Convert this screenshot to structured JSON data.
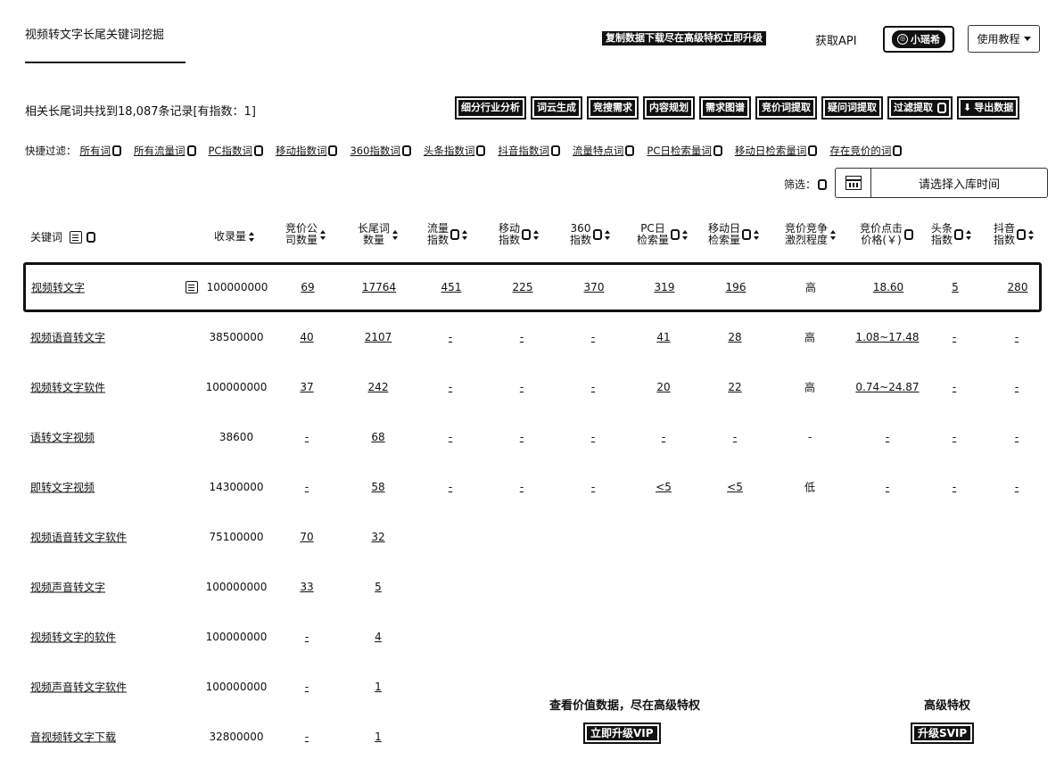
{
  "header": {
    "title": "视频转文字长尾关键词挖掘",
    "promo": "复制数据下载尽在高级特权立即升级",
    "api": "获取API",
    "xiaoshui": "小瑶希",
    "tutorial": "使用教程"
  },
  "summary": "相关长尾词共找到18,087条记录[有指数：1]",
  "tools": [
    "细分行业分析",
    "词云生成",
    "竞搜需求",
    "内容规划",
    "需求图谱",
    "竞价词提取",
    "疑问词提取",
    "过滤提取",
    "导出数据"
  ],
  "quick_filter": {
    "label": "快捷过滤：",
    "items": [
      "所有词",
      "所有流量词",
      "PC指数词",
      "移动指数词",
      "360指数词",
      "头条指数词",
      "抖音指数词",
      "流量特点词",
      "PC日检索量词",
      "移动日检索量词",
      "存在竞价的词"
    ]
  },
  "filter": {
    "label": "筛选：",
    "date_placeholder": "请选择入库时间"
  },
  "columns": {
    "keyword": "关键词",
    "collected": "收录量",
    "bid_company_1": "竞价公",
    "bid_company_2": "司数量",
    "longtail_1": "长尾词",
    "longtail_2": "数量",
    "traffic_1": "流量",
    "traffic_2": "指数",
    "mobile_1": "移动",
    "mobile_2": "指数",
    "i360_1": "360",
    "i360_2": "指数",
    "pc_1": "PC日",
    "pc_2": "检索量",
    "mobile_daily_1": "移动日",
    "mobile_daily_2": "检索量",
    "competition_1": "竞价竞争",
    "competition_2": "激烈程度",
    "cpc_1": "竞价点击",
    "cpc_2": "价格(￥)",
    "toutiao_1": "头条",
    "toutiao_2": "指数",
    "douyin_1": "抖音",
    "douyin_2": "指数"
  },
  "rows": [
    {
      "kw": "视频转文字",
      "collected": "100000000",
      "bid": "69",
      "longtail": "17764",
      "traffic": "451",
      "mobile": "225",
      "i360": "370",
      "pc": "319",
      "mobile_daily": "196",
      "competition": "高",
      "cpc": "18.60",
      "toutiao": "5",
      "douyin": "280"
    },
    {
      "kw": "视频语音转文字",
      "collected": "38500000",
      "bid": "40",
      "longtail": "2107",
      "traffic": "-",
      "mobile": "-",
      "i360": "-",
      "pc": "41",
      "mobile_daily": "28",
      "competition": "高",
      "cpc": "1.08~17.48",
      "toutiao": "-",
      "douyin": "-"
    },
    {
      "kw": "视频转文字软件",
      "collected": "100000000",
      "bid": "37",
      "longtail": "242",
      "traffic": "-",
      "mobile": "-",
      "i360": "-",
      "pc": "20",
      "mobile_daily": "22",
      "competition": "高",
      "cpc": "0.74~24.87",
      "toutiao": "-",
      "douyin": "-"
    },
    {
      "kw": "语转文字视频",
      "collected": "38600",
      "bid": "-",
      "longtail": "68",
      "traffic": "-",
      "mobile": "-",
      "i360": "-",
      "pc": "-",
      "mobile_daily": "-",
      "competition": "-",
      "cpc": "-",
      "toutiao": "-",
      "douyin": "-"
    },
    {
      "kw": "即转文字视频",
      "collected": "14300000",
      "bid": "-",
      "longtail": "58",
      "traffic": "-",
      "mobile": "-",
      "i360": "-",
      "pc": "<5",
      "mobile_daily": "<5",
      "competition": "低",
      "cpc": "-",
      "toutiao": "-",
      "douyin": "-"
    },
    {
      "kw": "视频语音转文字软件",
      "collected": "75100000",
      "bid": "70",
      "longtail": "32"
    },
    {
      "kw": "视频声音转文字",
      "collected": "100000000",
      "bid": "33",
      "longtail": "5"
    },
    {
      "kw": "视频转文字的软件",
      "collected": "100000000",
      "bid": "-",
      "longtail": "4"
    },
    {
      "kw": "视频声音转文字软件",
      "collected": "100000000",
      "bid": "-",
      "longtail": "1"
    },
    {
      "kw": "音视频转文字下载",
      "collected": "32800000",
      "bid": "-",
      "longtail": "1"
    }
  ],
  "upsell": {
    "vip_title": "查看价值数据，尽在高级特权",
    "vip_button": "立即升级VIP",
    "svip_title": "高级特权",
    "svip_button": "升级SVIP"
  }
}
